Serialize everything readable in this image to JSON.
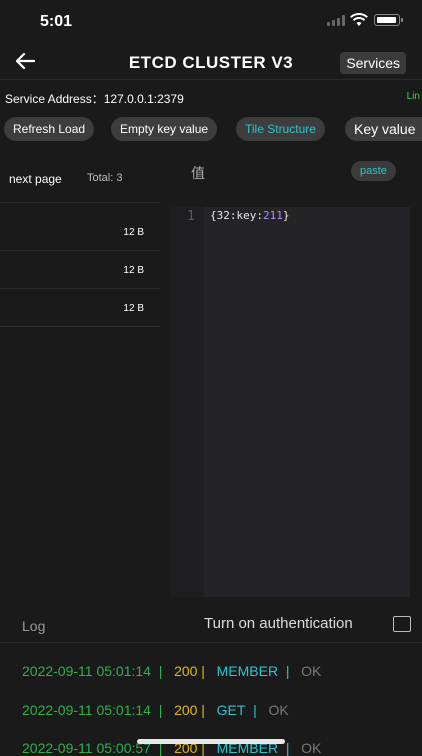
{
  "status_bar": {
    "time": "5:01"
  },
  "nav": {
    "back_icon": "arrow-left-icon",
    "title": "ETCD CLUSTER V3",
    "services_label": "Services"
  },
  "address": {
    "label": "Service Address：127.0.0.1:2379",
    "right_text": "Lin"
  },
  "toolbar": {
    "refresh": "Refresh Load",
    "empty": "Empty key value",
    "tile": "Tile Structure",
    "keyvalue": "Key value"
  },
  "left_pane": {
    "next_page": "next page",
    "total": "Total:  3",
    "rows": [
      {
        "size": "12 B"
      },
      {
        "size": "12 B"
      },
      {
        "size": "12 B"
      }
    ]
  },
  "editor": {
    "header": "值",
    "paste_label": "paste",
    "line_number": "1",
    "code_prefix": "{32:key:",
    "code_number": "211",
    "code_suffix": "}"
  },
  "bottom": {
    "log_label": "Log",
    "auth_label": "Turn on authentication",
    "logs": [
      {
        "date": "2022-09-11 05:01:14",
        "code": "200",
        "method": "MEMBER",
        "status": "OK"
      },
      {
        "date": "2022-09-11 05:01:14",
        "code": "200",
        "method": "GET",
        "status": "OK"
      },
      {
        "date": "2022-09-11 05:00:57",
        "code": "200",
        "method": "MEMBER",
        "status": "OK"
      }
    ]
  },
  "colors": {
    "accent": "#2ec4ce",
    "log_date": "#2fb24a",
    "log_code": "#e2b817",
    "address_right": "#39d353"
  }
}
